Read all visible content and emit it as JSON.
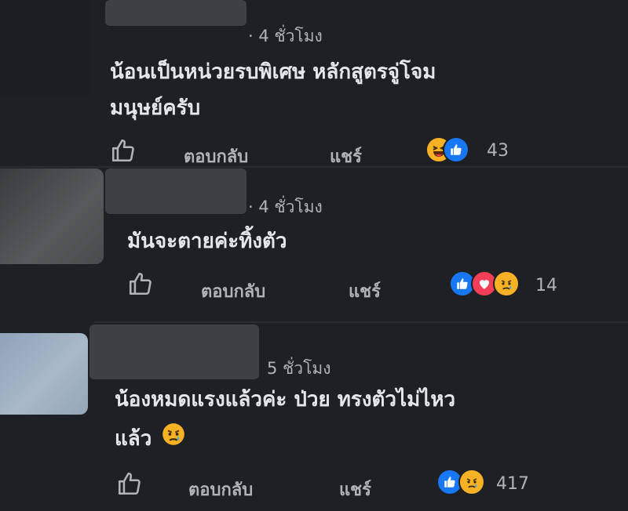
{
  "comments": [
    {
      "time": "· 4 ชั่วโมง",
      "lines": [
        "น้อนเป็นหน่วยรบพิเศษ หลักสูตรจู่โจม",
        "มนุษย์ครับ"
      ],
      "reply_label": "ตอบกลับ",
      "share_label": "แชร์",
      "reactions": [
        "haha-emoji-icon",
        "like-reaction-icon"
      ],
      "reaction_count": "43"
    },
    {
      "time": "· 4 ชั่วโมง",
      "lines": [
        "มันจะตายค่ะทิ้งตัว"
      ],
      "reply_label": "ตอบกลับ",
      "share_label": "แชร์",
      "reactions": [
        "like-reaction-icon",
        "love-reaction-icon",
        "sad-emoji-icon"
      ],
      "reaction_count": "14"
    },
    {
      "time": "5 ชั่วโมง",
      "lines": [
        "น้องหมดแรงแล้วค่ะ ป่วย ทรงตัวไม่ไหว",
        "แล้ว"
      ],
      "reply_label": "ตอบกลับ",
      "share_label": "แชร์",
      "reactions": [
        "like-reaction-icon",
        "sad-emoji-icon"
      ],
      "reaction_count": "417"
    }
  ],
  "colors": {
    "background": "#1f2023",
    "text": "#e4e6eb",
    "muted": "#b0b3b8",
    "like_blue": "#1877f2",
    "love_red": "#f33e58",
    "emoji_yellow": "#f7b125"
  }
}
